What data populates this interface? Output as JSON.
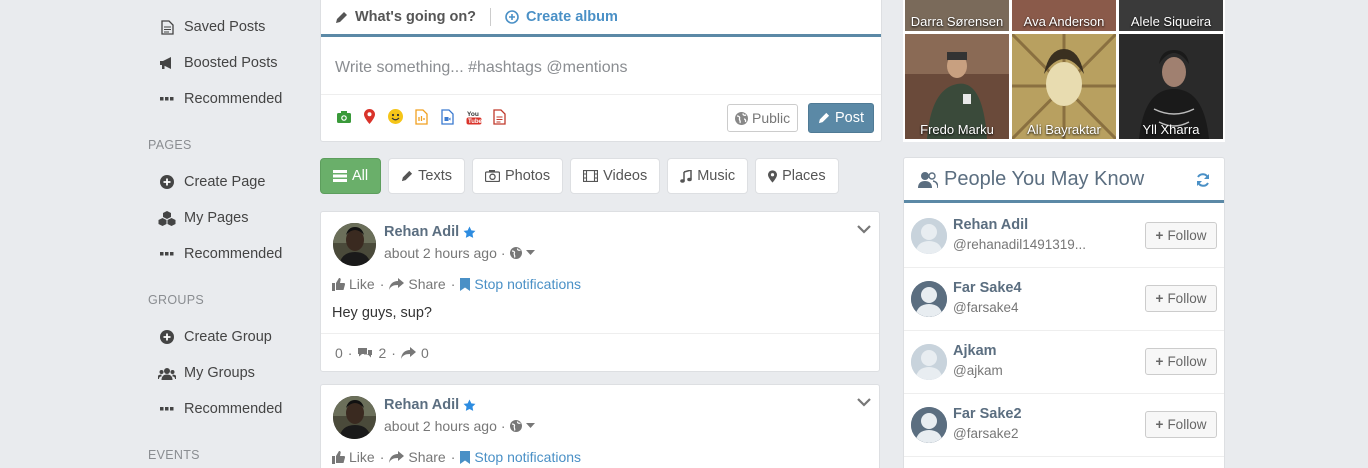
{
  "sidebar": {
    "items_top": [
      {
        "label": "Saved Posts",
        "icon": "document-icon"
      },
      {
        "label": "Boosted Posts",
        "icon": "megaphone-icon"
      },
      {
        "label": "Recommended",
        "icon": "ellipsis-icon"
      }
    ],
    "pages_heading": "PAGES",
    "pages_items": [
      {
        "label": "Create Page",
        "icon": "plus-circle-icon"
      },
      {
        "label": "My Pages",
        "icon": "cubes-icon"
      },
      {
        "label": "Recommended",
        "icon": "ellipsis-icon"
      }
    ],
    "groups_heading": "GROUPS",
    "groups_items": [
      {
        "label": "Create Group",
        "icon": "plus-circle-icon"
      },
      {
        "label": "My Groups",
        "icon": "users-icon"
      },
      {
        "label": "Recommended",
        "icon": "ellipsis-icon"
      }
    ],
    "events_heading": "EVENTS"
  },
  "publisher": {
    "tab_status": "What's going on?",
    "tab_album": "Create album",
    "placeholder": "Write something... #hashtags @mentions",
    "public_label": "Public",
    "post_label": "Post"
  },
  "filters": [
    "All",
    "Texts",
    "Photos",
    "Videos",
    "Music",
    "Places"
  ],
  "posts": [
    {
      "author": "Rehan Adil",
      "time": "about 2 hours ago",
      "like": "Like",
      "share": "Share",
      "stop": "Stop notifications",
      "body": "Hey guys, sup?",
      "likes": "0",
      "comments": "2",
      "shares": "0"
    },
    {
      "author": "Rehan Adil",
      "time": "about 2 hours ago",
      "like": "Like",
      "share": "Share",
      "stop": "Stop notifications"
    }
  ],
  "photos": {
    "top_row": [
      "Darra Sørensen",
      "Ava Anderson",
      "Alele Siqueira"
    ],
    "bottom_row": [
      "Fredo Marku",
      "Ali Bayraktar",
      "Yll Xharra"
    ]
  },
  "pymk": {
    "title": "People You May Know",
    "follow_label": "Follow",
    "people": [
      {
        "name": "Rehan Adil",
        "handle": "@rehanadil1491319..."
      },
      {
        "name": "Far Sake4",
        "handle": "@farsake4"
      },
      {
        "name": "Ajkam",
        "handle": "@ajkam"
      },
      {
        "name": "Far Sake2",
        "handle": "@farsake2"
      }
    ]
  },
  "colors": {
    "accent": "#5b89a6",
    "link": "#4a90c6",
    "active_filter": "#6aaf6a",
    "background": "#e9ebee"
  }
}
